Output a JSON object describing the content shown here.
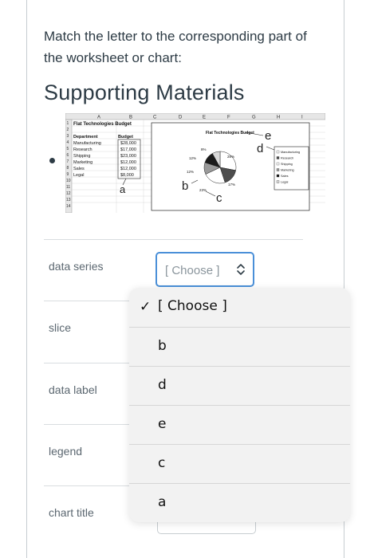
{
  "question": {
    "instructions": "Match the letter to the corresponding part of the worksheet or chart:",
    "section_title": "Supporting Materials"
  },
  "worksheet": {
    "columns": [
      "A",
      "B",
      "C",
      "D",
      "E",
      "F",
      "G",
      "H",
      "I"
    ],
    "row_numbers": [
      "1",
      "2",
      "3",
      "4",
      "5",
      "6",
      "7",
      "8",
      "9",
      "10",
      "11",
      "12",
      "13",
      "14"
    ],
    "sheet_title": "Flat Technologies Budget",
    "header_department": "Department",
    "header_budget": "Budget",
    "departments": [
      "Manufacturing",
      "Research",
      "Shipping",
      "Marketing",
      "Sales",
      "Legal"
    ],
    "budgets": [
      "$28,000",
      "$17,000",
      "$23,000",
      "$12,000",
      "$12,000",
      "$8,000"
    ],
    "chart_title": "Flat Technologies Budget",
    "legend_items": [
      "Manufacturing",
      "Research",
      "Shipping",
      "Marketing",
      "Sales",
      "Legal"
    ],
    "data_labels": [
      "8%",
      "28%",
      "12%",
      "12%",
      "23%",
      "17%"
    ],
    "callouts": {
      "a": "a",
      "b": "b",
      "c": "c",
      "d": "d",
      "e": "e"
    }
  },
  "chart_data": {
    "type": "pie",
    "title": "Flat Technologies Budget",
    "categories": [
      "Manufacturing",
      "Research",
      "Shipping",
      "Marketing",
      "Sales",
      "Legal"
    ],
    "values": [
      28000,
      17000,
      23000,
      12000,
      12000,
      8000
    ],
    "legend": "right"
  },
  "match_rows": [
    {
      "label": "data series"
    },
    {
      "label": "slice"
    },
    {
      "label": "data label"
    },
    {
      "label": "legend"
    },
    {
      "label": "chart title"
    }
  ],
  "select": {
    "current_value": "[ Choose ]"
  },
  "dropdown": {
    "options": [
      "[ Choose ]",
      "b",
      "d",
      "e",
      "c",
      "a"
    ],
    "check_mark": "✓"
  }
}
